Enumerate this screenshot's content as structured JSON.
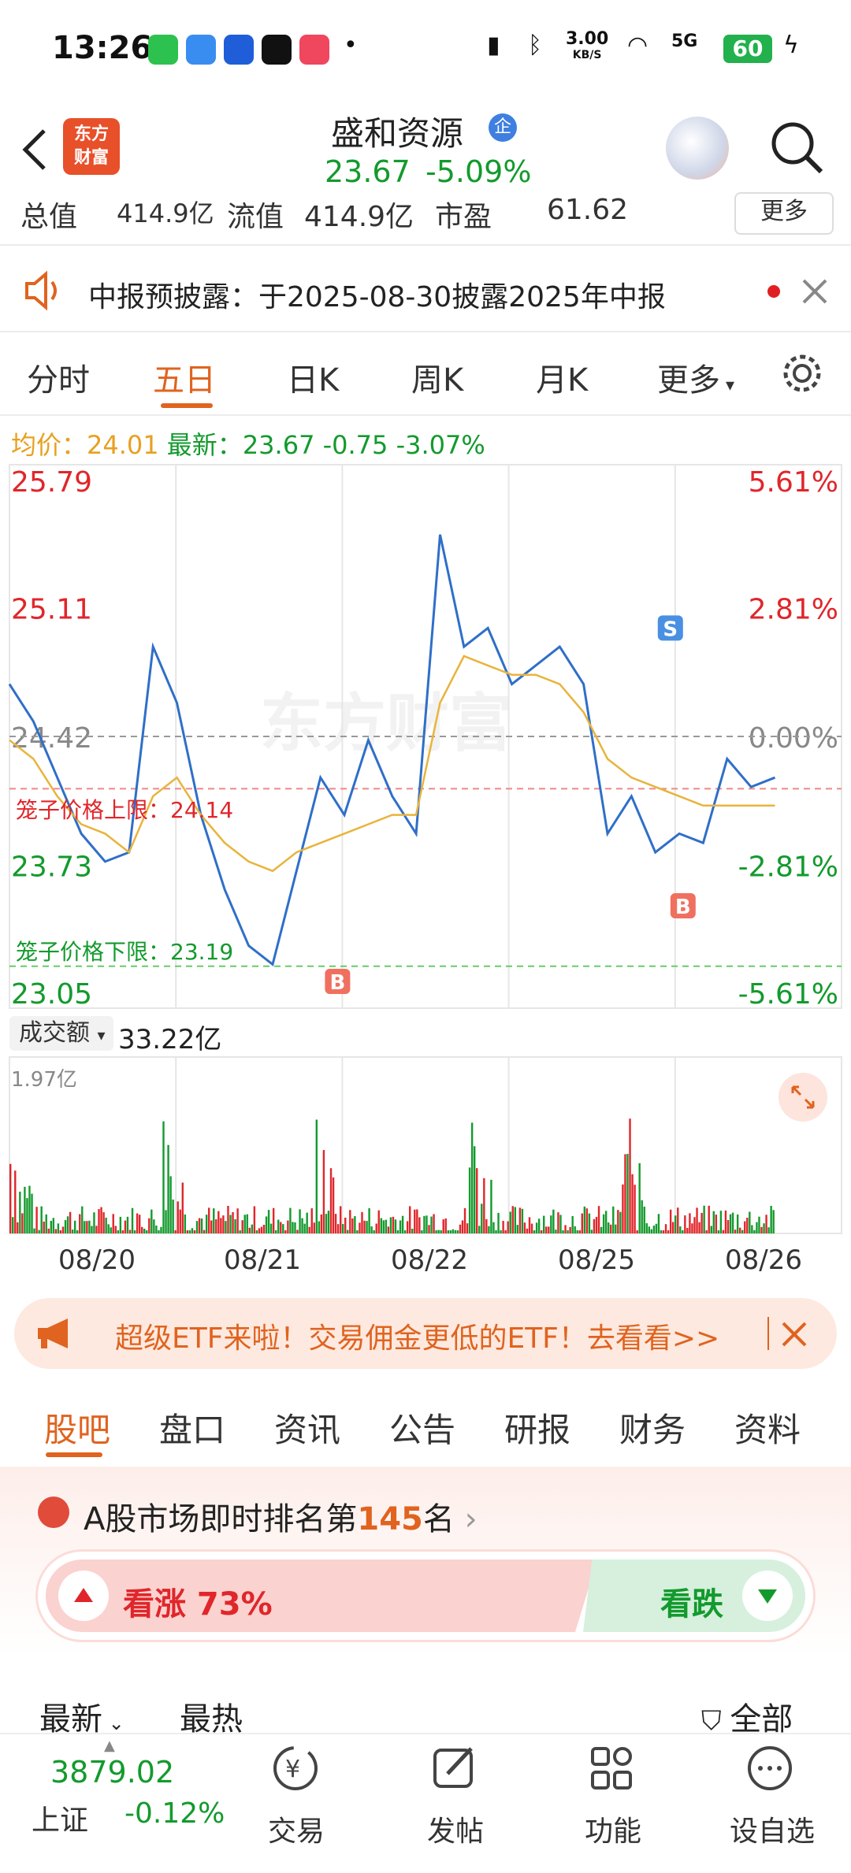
{
  "status_bar": {
    "time": "13:26",
    "net_speed_value": "3.00",
    "net_speed_unit": "KB/S",
    "network": "5G",
    "battery": "60"
  },
  "header": {
    "logo_line1": "东方",
    "logo_line2": "财富",
    "stock_name": "盛和资源",
    "badge": "企",
    "price": "23.67",
    "change_pct": "-5.09%"
  },
  "metrics": {
    "total_label": "总值",
    "total_value": "414.9亿",
    "float_label": "流值",
    "float_value": "414.9亿",
    "pe_label": "市盈",
    "pe_value": "61.62",
    "more": "更多"
  },
  "notice": {
    "text": "中报预披露：于2025-08-30披露2025年中报"
  },
  "chart_tabs": [
    "分时",
    "五日",
    "日K",
    "周K",
    "月K",
    "更多"
  ],
  "chart_info": {
    "avg_label": "均价：",
    "avg_value": "24.01",
    "latest_label": "最新：",
    "latest_value": "23.67",
    "change": "-0.75",
    "change_pct": "-3.07%"
  },
  "watermark": "东方财富",
  "chart_data": {
    "type": "line",
    "x": [
      "08/20",
      "08/21",
      "08/22",
      "08/25",
      "08/26"
    ],
    "y_ticks_left": [
      "25.79",
      "25.11",
      "24.42",
      "23.73",
      "23.05"
    ],
    "y_ticks_right": [
      "5.61%",
      "2.81%",
      "0.00%",
      "-2.81%",
      "-5.61%"
    ],
    "ylim": [
      23.05,
      25.79
    ],
    "upper_limit_label": "笼子价格上限：24.14",
    "upper_limit": 24.14,
    "lower_limit_label": "笼子价格下限：23.19",
    "lower_limit": 23.19,
    "prev_close": 24.42,
    "series": [
      {
        "name": "最新",
        "color": "#2f6fc8",
        "values": [
          24.7,
          24.5,
          24.2,
          23.9,
          23.75,
          23.8,
          24.9,
          24.6,
          24.0,
          23.6,
          23.3,
          23.2,
          23.7,
          24.2,
          24.0,
          24.4,
          24.1,
          23.9,
          25.5,
          24.9,
          25.0,
          24.7,
          24.8,
          24.9,
          24.7,
          23.9,
          24.1,
          23.8,
          23.9,
          23.85,
          24.3,
          24.15,
          24.2
        ]
      },
      {
        "name": "均价",
        "color": "#e8b43c",
        "values": [
          24.4,
          24.3,
          24.1,
          23.95,
          23.9,
          23.8,
          24.1,
          24.2,
          24.0,
          23.85,
          23.75,
          23.7,
          23.8,
          23.85,
          23.9,
          23.95,
          24.0,
          24.0,
          24.6,
          24.85,
          24.8,
          24.75,
          24.75,
          24.7,
          24.55,
          24.3,
          24.2,
          24.15,
          24.1,
          24.05,
          24.05,
          24.05,
          24.05
        ]
      }
    ],
    "markers": [
      {
        "label": "B",
        "day": "08/21"
      },
      {
        "label": "S",
        "day": "08/25"
      },
      {
        "label": "B",
        "day": "08/26"
      }
    ],
    "volume_label": "成交额",
    "volume_total": "33.22亿",
    "volume_max": "1.97亿"
  },
  "promo": {
    "text": "超级ETF来啦！交易佣金更低的ETF！去看看>>"
  },
  "section_tabs": [
    "股吧",
    "盘口",
    "资讯",
    "公告",
    "研报",
    "财务",
    "资料"
  ],
  "rank": {
    "prefix": "A股市场即时排名第",
    "number": "145",
    "suffix": "名"
  },
  "vote": {
    "up_label": "看涨 73%",
    "down_label": "看跌"
  },
  "sort": {
    "latest": "最新",
    "hot": "最热",
    "all": "全部"
  },
  "bottom_nav": {
    "index_value": "3879.02",
    "index_name": "上证",
    "index_change": "-0.12%",
    "trade": "交易",
    "post": "发帖",
    "features": "功能",
    "watchlist": "设自选"
  },
  "colors": {
    "accent": "#e0631f",
    "up": "#e0262b",
    "down": "#139a2d",
    "price_line": "#2f6fc8",
    "avg_line": "#e8b43c"
  }
}
